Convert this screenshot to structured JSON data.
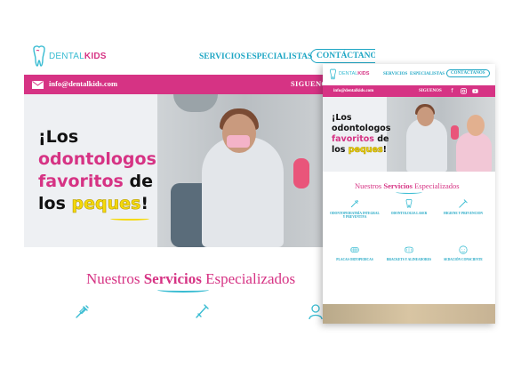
{
  "brand": {
    "logo_part_a": "DENTAL",
    "logo_part_b": "KIDS",
    "pink": "#d63384",
    "teal": "#1ea6c4",
    "light_teal": "#39bcd2",
    "yellow": "#f5d90a"
  },
  "main": {
    "nav": {
      "services": "SERVICIOS",
      "specialists": "ESPECIALISTAS",
      "contact": "CONTÁCTANOS"
    },
    "bar": {
      "email": "info@dentalkids.com",
      "follow": "SIGUENOS"
    },
    "hero": {
      "line1": "¡Los",
      "line2": "odontologos",
      "line3a": "favoritos",
      "line3b": "de",
      "line4a": "los",
      "line4b": "peques",
      "line4c": "!"
    },
    "services": {
      "title_a": "Nuestros",
      "title_b": "Servicios",
      "title_c": "Especializados"
    }
  },
  "front": {
    "nav": {
      "services": "SERVICIOS",
      "specialists": "ESPECIALISTAS",
      "contact": "CONTÁCTANOS"
    },
    "bar": {
      "email": "info@dentalkids.com",
      "follow": "SIGUENOS",
      "social_icons": [
        "facebook-icon",
        "instagram-icon",
        "youtube-icon"
      ]
    },
    "hero": {
      "line1": "¡Los",
      "line2": "odontologos",
      "line3a": "favoritos",
      "line3b": "de",
      "line4a": "los",
      "line4b": "peques",
      "line4c": "!"
    },
    "services": {
      "title_a": "Nuestros",
      "title_b": "Servicios",
      "title_c": "Especializados",
      "items": [
        {
          "icon": "syringe-icon",
          "title": "ODONTOPEDIATRÍA INTEGRAL Y PREVENTIVA",
          "desc": ""
        },
        {
          "icon": "tooth-laser-icon",
          "title": "ODONTOLOGIA LASER",
          "desc": ""
        },
        {
          "icon": "tooth-brush-icon",
          "title": "HIGIENE Y PREVENCION",
          "desc": ""
        },
        {
          "icon": "braces-icon",
          "title": "PLACAS ORTOPEDICAS",
          "desc": ""
        },
        {
          "icon": "aligner-icon",
          "title": "BRACKETS Y ALINEADORES",
          "desc": ""
        },
        {
          "icon": "sedation-icon",
          "title": "SEDACIÓN CONSCIENTE",
          "desc": ""
        }
      ]
    }
  }
}
